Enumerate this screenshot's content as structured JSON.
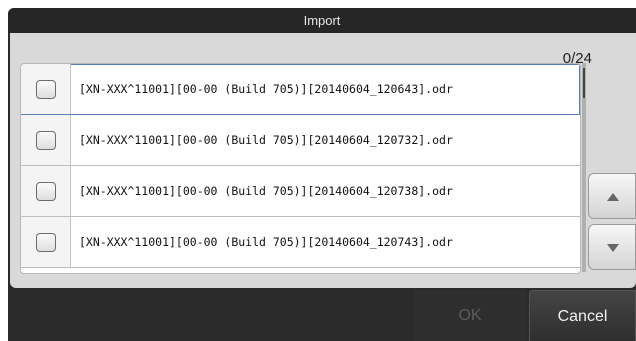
{
  "dialog": {
    "title": "Import",
    "counter": "0/24",
    "files": [
      {
        "name": "[XN-XXX^11001][00-00 (Build 705)][20140604_120643].odr",
        "checked": false
      },
      {
        "name": "[XN-XXX^11001][00-00 (Build 705)][20140604_120732].odr",
        "checked": false
      },
      {
        "name": "[XN-XXX^11001][00-00 (Build 705)][20140604_120738].odr",
        "checked": false
      },
      {
        "name": "[XN-XXX^11001][00-00 (Build 705)][20140604_120743].odr",
        "checked": false
      }
    ],
    "scroll_up_icon": "triangle-up-icon",
    "scroll_down_icon": "triangle-down-icon",
    "ok_label": "OK",
    "cancel_label": "Cancel",
    "ok_disabled": true
  }
}
